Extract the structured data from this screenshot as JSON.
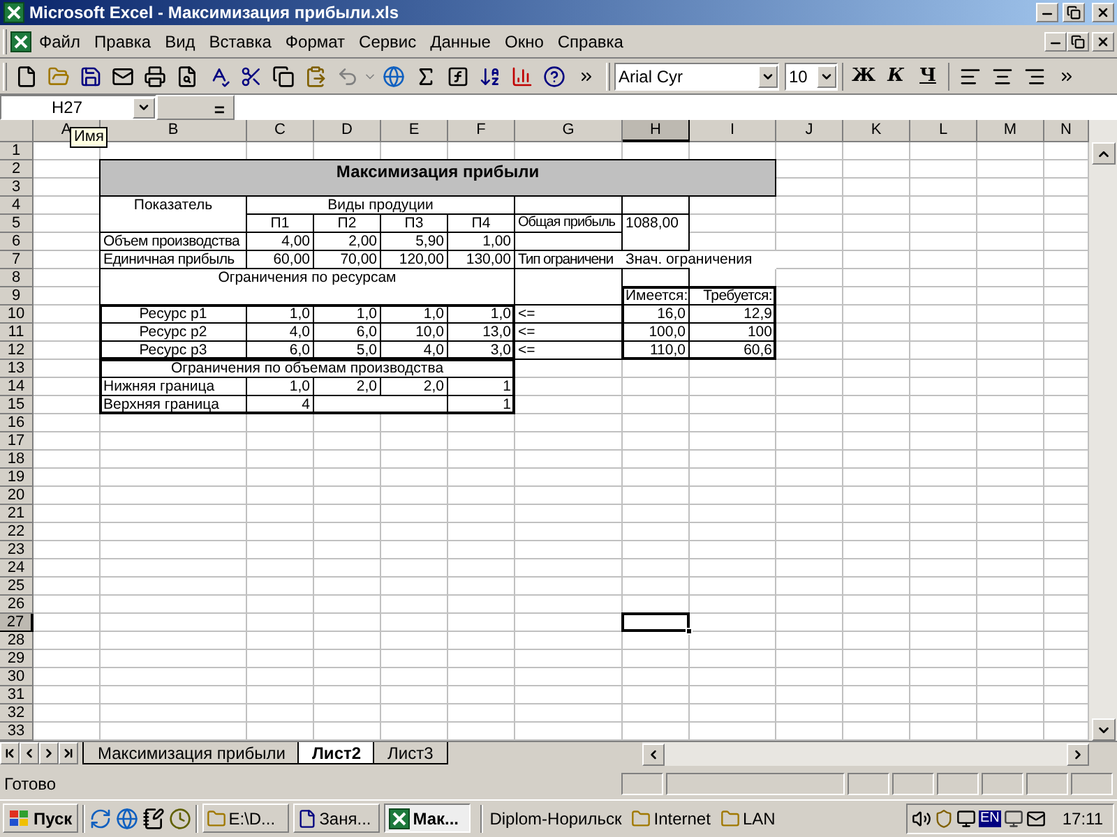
{
  "window": {
    "title": "Microsoft Excel - Максимизация прибыли.xls"
  },
  "menu": [
    "Файл",
    "Правка",
    "Вид",
    "Вставка",
    "Формат",
    "Сервис",
    "Данные",
    "Окно",
    "Справка"
  ],
  "toolbar": {
    "font": "Arial Cyr",
    "size": "10",
    "format_buttons": [
      "Ж",
      "К",
      "Ч"
    ]
  },
  "formula_bar": {
    "name_box": "H27",
    "equals": "=",
    "tooltip": "Имя"
  },
  "columns": [
    {
      "label": "A",
      "selected": false
    },
    {
      "label": "B",
      "selected": false
    },
    {
      "label": "C",
      "selected": false
    },
    {
      "label": "D",
      "selected": false
    },
    {
      "label": "E",
      "selected": false
    },
    {
      "label": "F",
      "selected": false
    },
    {
      "label": "G",
      "selected": false
    },
    {
      "label": "H",
      "selected": true
    },
    {
      "label": "I",
      "selected": false
    },
    {
      "label": "J",
      "selected": false
    },
    {
      "label": "K",
      "selected": false
    },
    {
      "label": "L",
      "selected": false
    },
    {
      "label": "M",
      "selected": false
    },
    {
      "label": "N",
      "selected": false
    }
  ],
  "row_numbers": [
    {
      "label": "1",
      "selected": false
    },
    {
      "label": "2",
      "selected": false
    },
    {
      "label": "3",
      "selected": false
    },
    {
      "label": "4",
      "selected": false
    },
    {
      "label": "5",
      "selected": false
    },
    {
      "label": "6",
      "selected": false
    },
    {
      "label": "7",
      "selected": false
    },
    {
      "label": "8",
      "selected": false
    },
    {
      "label": "9",
      "selected": false
    },
    {
      "label": "10",
      "selected": false
    },
    {
      "label": "11",
      "selected": false
    },
    {
      "label": "12",
      "selected": false
    },
    {
      "label": "13",
      "selected": false
    },
    {
      "label": "14",
      "selected": false
    },
    {
      "label": "15",
      "selected": false
    },
    {
      "label": "16",
      "selected": false
    },
    {
      "label": "17",
      "selected": false
    },
    {
      "label": "18",
      "selected": false
    },
    {
      "label": "19",
      "selected": false
    },
    {
      "label": "20",
      "selected": false
    },
    {
      "label": "21",
      "selected": false
    },
    {
      "label": "22",
      "selected": false
    },
    {
      "label": "23",
      "selected": false
    },
    {
      "label": "24",
      "selected": false
    },
    {
      "label": "25",
      "selected": false
    },
    {
      "label": "26",
      "selected": false
    },
    {
      "label": "27",
      "selected": true
    },
    {
      "label": "28",
      "selected": false
    },
    {
      "label": "29",
      "selected": false
    },
    {
      "label": "30",
      "selected": false
    },
    {
      "label": "31",
      "selected": false
    },
    {
      "label": "32",
      "selected": false
    },
    {
      "label": "33",
      "selected": false
    }
  ],
  "sheet": {
    "title": "Максимизация прибыли",
    "indicator_header": "Показатель",
    "products_header": "Виды продуции",
    "products": [
      "П1",
      "П2",
      "П3",
      "П4"
    ],
    "total_label": "Общая прибыль",
    "total_value": "1088,00",
    "metrics": [
      {
        "label": "Объем производства",
        "values": [
          "4,00",
          "2,00",
          "5,90",
          "1,00"
        ]
      },
      {
        "label": "Единичная прибыль",
        "values": [
          "60,00",
          "70,00",
          "120,00",
          "130,00"
        ]
      }
    ],
    "constraint_type_header": "Тип ограничени",
    "constraint_value_header": "Знач. ограничения",
    "resources_header": "Ограничения по ресурсам",
    "available_header": "Имеется:",
    "required_header": "Требуется:",
    "resources": [
      {
        "label": "Ресурс р1",
        "values": [
          "1,0",
          "1,0",
          "1,0",
          "1,0"
        ],
        "sign": "<=",
        "available": "16,0",
        "required": "12,9"
      },
      {
        "label": "Ресурс р2",
        "values": [
          "4,0",
          "6,0",
          "10,0",
          "13,0"
        ],
        "sign": "<=",
        "available": "100,0",
        "required": "100"
      },
      {
        "label": "Ресурс р3",
        "values": [
          "6,0",
          "5,0",
          "4,0",
          "3,0"
        ],
        "sign": "<=",
        "available": "110,0",
        "required": "60,6"
      }
    ],
    "volume_header": "Ограничения по объемам производства",
    "bounds": [
      {
        "label": "Нижняя граница",
        "values": {
          "p1": "1,0",
          "p2": "2,0",
          "p3": "2,0",
          "p4": "1"
        }
      },
      {
        "label": "Верхняя граница",
        "values": {
          "p1": "4",
          "p4": "1"
        }
      }
    ]
  },
  "sheet_tabs": [
    {
      "label": "Максимизация прибыли",
      "selected": false
    },
    {
      "label": "Лист2",
      "selected": true
    },
    {
      "label": "Лист3",
      "selected": false
    }
  ],
  "status": "Готово",
  "taskbar": {
    "start": "Пуск",
    "tasks": [
      {
        "label": "E:\\D...",
        "kind": "folder",
        "selected": false
      },
      {
        "label": "Заня...",
        "kind": "word",
        "selected": false
      },
      {
        "label": "Мак...",
        "kind": "excel",
        "selected": true
      }
    ],
    "links": [
      "Diplom-Норильск",
      "Internet",
      "LAN"
    ],
    "language": "EN",
    "clock": "17:11"
  }
}
